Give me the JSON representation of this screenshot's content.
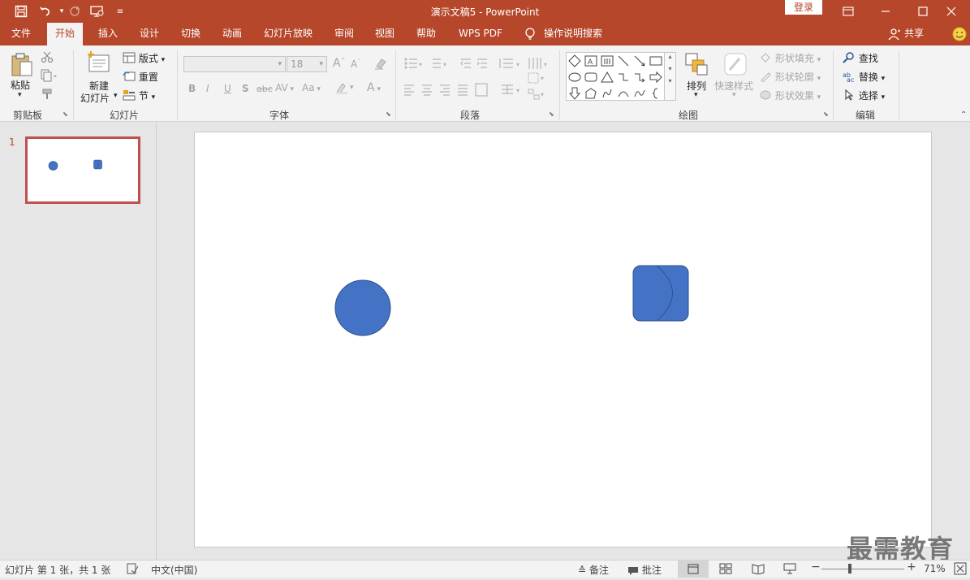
{
  "titlebar": {
    "doc_title": "演示文稿5  -  PowerPoint",
    "login_label": "登录"
  },
  "tabs": [
    {
      "label": "文件"
    },
    {
      "label": "开始"
    },
    {
      "label": "插入"
    },
    {
      "label": "设计"
    },
    {
      "label": "切换"
    },
    {
      "label": "动画"
    },
    {
      "label": "幻灯片放映"
    },
    {
      "label": "审阅"
    },
    {
      "label": "视图"
    },
    {
      "label": "帮助"
    },
    {
      "label": "WPS PDF"
    },
    {
      "label": "操作说明搜索"
    }
  ],
  "share_label": "共享",
  "ribbon": {
    "clipboard": {
      "paste": "粘贴",
      "group": "剪贴板"
    },
    "slides": {
      "new_line1": "新建",
      "new_line2": "幻灯片",
      "layout": "版式",
      "reset": "重置",
      "section": "节",
      "group": "幻灯片"
    },
    "font": {
      "size_value": "18",
      "group": "字体",
      "bold": "B",
      "italic": "I",
      "underline": "U",
      "shadow": "S",
      "strike": "abc",
      "spacing": "AV",
      "case": "Aa"
    },
    "paragraph": {
      "group": "段落"
    },
    "drawing": {
      "arrange": "排列",
      "quick_styles": "快速样式",
      "fill": "形状填充",
      "outline": "形状轮廓",
      "effects": "形状效果",
      "group": "绘图"
    },
    "editing": {
      "find": "查找",
      "replace": "替换",
      "select": "选择",
      "group": "编辑"
    }
  },
  "slides_panel": {
    "slide_number": "1"
  },
  "statusbar": {
    "slide_info": "幻灯片 第 1 张，共 1 张",
    "language": "中文(中国)",
    "notes": "备注",
    "comments": "批注",
    "zoom": "71%"
  },
  "watermark": "最需教育",
  "colors": {
    "brand": "#b7472a",
    "shape_fill": "#4472c4",
    "shape_stroke": "#2f528f"
  }
}
